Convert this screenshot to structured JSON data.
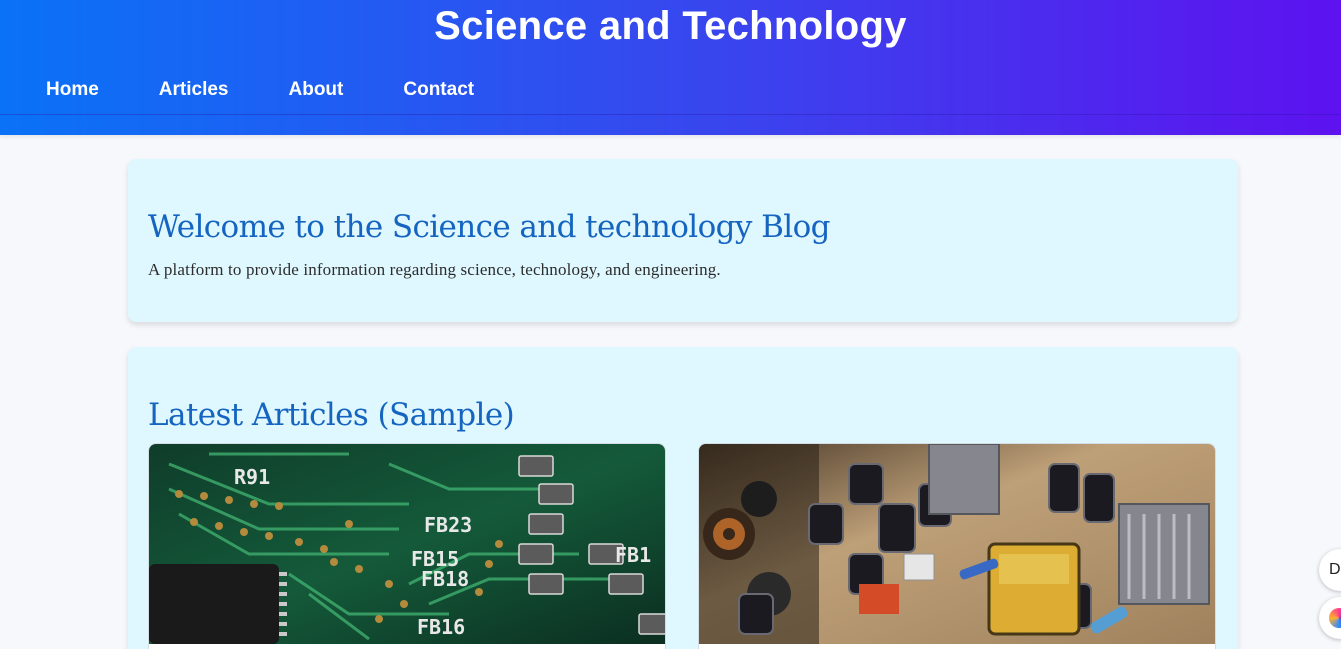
{
  "header": {
    "title": "Science and Technology",
    "nav": [
      "Home",
      "Articles",
      "About",
      "Contact"
    ]
  },
  "hero": {
    "title": "Welcome to the Science and technology Blog",
    "description": "A platform to provide information regarding science, technology, and engineering."
  },
  "articles": {
    "title": "Latest Articles (Sample)",
    "images": [
      {
        "icon": "circuit-board-image",
        "labels": [
          "R91",
          "FB23",
          "FB15",
          "FB18",
          "FB16",
          "FB1"
        ]
      },
      {
        "icon": "electronics-components-image"
      }
    ]
  },
  "floating": {
    "button1_text": "D",
    "button2_icon": "assistant-orb-icon"
  },
  "colors": {
    "header_gradient_start": "#0a72f6",
    "header_gradient_end": "#5d12ef",
    "card_bg": "#dff8ff",
    "heading": "#1565c0"
  }
}
